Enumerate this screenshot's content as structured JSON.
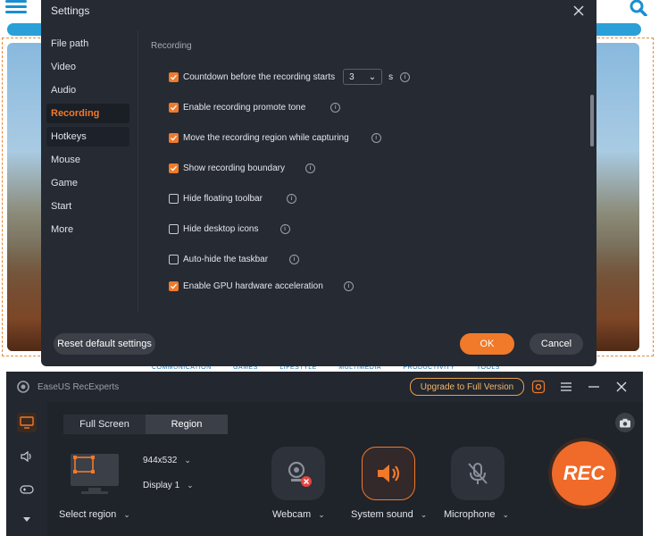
{
  "background_page": {
    "nav_items": [
      "COMMUNICATION",
      "GAMES",
      "LIFESTYLE",
      "MULTIMEDIA",
      "PRODUCTIVITY",
      "TOOLS"
    ]
  },
  "settings": {
    "title": "Settings",
    "sidebar": [
      {
        "label": "File path"
      },
      {
        "label": "Video"
      },
      {
        "label": "Audio"
      },
      {
        "label": "Recording"
      },
      {
        "label": "Hotkeys"
      },
      {
        "label": "Mouse"
      },
      {
        "label": "Game"
      },
      {
        "label": "Start"
      },
      {
        "label": "More"
      }
    ],
    "active_item": "Recording",
    "section_title": "Recording",
    "options": [
      {
        "label": "Countdown before the recording starts",
        "checked": true
      },
      {
        "label": "Enable recording promote tone",
        "checked": true
      },
      {
        "label": "Move the recording region while capturing",
        "checked": true
      },
      {
        "label": "Show recording boundary",
        "checked": true
      },
      {
        "label": "Hide floating toolbar",
        "checked": false
      },
      {
        "label": "Hide desktop icons",
        "checked": false
      },
      {
        "label": "Auto-hide the taskbar",
        "checked": false
      },
      {
        "label": "Enable GPU hardware acceleration",
        "checked": true
      }
    ],
    "countdown_value": "3",
    "countdown_unit": "s",
    "info_glyph": "i",
    "buttons": {
      "reset": "Reset default settings",
      "ok": "OK",
      "cancel": "Cancel"
    },
    "accent_color": "#f07a2a"
  },
  "recorder": {
    "app_name": "EaseUS RecExperts",
    "upgrade_label": "Upgrade to Full Version",
    "tabs": {
      "full_screen": "Full Screen",
      "region": "Region"
    },
    "resolution": "944x532",
    "display": "Display 1",
    "select_region_label": "Select region",
    "webcam_label": "Webcam",
    "system_sound_label": "System sound",
    "microphone_label": "Microphone",
    "rec_label": "REC"
  }
}
